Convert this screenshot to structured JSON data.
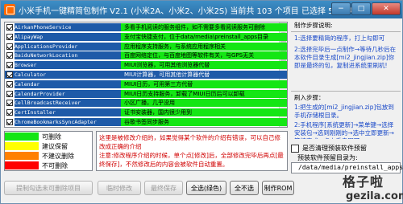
{
  "window": {
    "title": "小米手机一键精简包制作  V2.1  (小米2A、小米2、小米2S)    当前共 103 个项目    已选择 53 个项目",
    "minimize_label": "−",
    "maximize_label": "□",
    "close_label": "✕"
  },
  "apps": [
    {
      "package": "AirkanPhoneService",
      "desc": "多看手机阅读的服务组件，如不需要多看阅读服务可删除",
      "checked": true,
      "style": "green"
    },
    {
      "package": "AlipayWap",
      "desc": "支付宝快捷支付，位于data/media\\preinstall_apps目录",
      "checked": true,
      "style": "green"
    },
    {
      "package": "ApplicationsProvider",
      "desc": "应用程序支持服务，与系统应用程序相关",
      "checked": true,
      "style": "green"
    },
    {
      "package": "BaiduNetworkLocation",
      "desc": "百度网络定位，与百度地图等软件有关，与GPS无关",
      "checked": true,
      "style": "green"
    },
    {
      "package": "Browser",
      "desc": "MIUI浏览器，可用其他浏览器代替",
      "checked": true,
      "style": "green"
    },
    {
      "package": "Calculator",
      "desc": "MIUI计算器，可用其他计算器代替",
      "checked": true,
      "style": "selected"
    },
    {
      "package": "Calendar",
      "desc": "MIUI日历，可用第三方代替",
      "checked": true,
      "style": "green"
    },
    {
      "package": "CalendarProvider",
      "desc": "MIUI日历支持服务，卸载了MIUI日历后可以卸载",
      "checked": true,
      "style": "green"
    },
    {
      "package": "CellBroadcastReceiver",
      "desc": "小区广播，几乎没用",
      "checked": true,
      "style": "green"
    },
    {
      "package": "CertInstaller",
      "desc": "证书安装器，国内很少用到",
      "checked": true,
      "style": "green"
    },
    {
      "package": "ChromeBookmarksSyncAdapter",
      "desc": "谷歌书签同步服务",
      "checked": true,
      "style": "green"
    }
  ],
  "legend": [
    {
      "label": "可删除",
      "color": "#14e614"
    },
    {
      "label": "建议保留",
      "color": "#ffff00"
    },
    {
      "label": "不建议删除",
      "color": "#ff8000"
    },
    {
      "label": "不可删除",
      "color": "#ff0000"
    }
  ],
  "info": {
    "line1": "这里是被修改介绍的，如果觉得某个软件的介绍有错误，可以自己修改成正确的介绍",
    "line2": "注意:修改程序介绍的时候，单个点[修改]后，全部修改完毕后再点[最终保存]，不然修改后的内容会被软件自动重置。"
  },
  "buttons": {
    "remove_unselected": "提制勾选未可删除项目",
    "temp_modify": "临时修改",
    "final_save": "最终保存",
    "select_all_green": "全选(绿色)",
    "select_none": "全不选",
    "make_zip": "制作ROM"
  },
  "instructions": {
    "title": "制作步骤说明:",
    "step1": "1:选择要精简的程序，打上勾即可",
    "step2": "2:选择完毕后一点制作→等待几秒后在本软件目录生成[mi2_jingjian.zip]你即是最终的包，复制进系统里刷机!",
    "flash_title": "刷入步骤：",
    "flash1": "1:把生成的[mi2_jingjian.zip]包放到手机存储根目录。",
    "flash2": "2:手机程序[系统更新]→菜单键→选择安装包→选到刚刚的→选中立即更新→等待完成→点击重启即可。"
  },
  "export": {
    "checkbox_label": "是否清理预装软件预留",
    "dir_label": "预装软件预留目录为:",
    "dir_value": "/data/media/preinstall_apps"
  },
  "watermark": {
    "text": "格子啦",
    "url": "gezila.com"
  }
}
